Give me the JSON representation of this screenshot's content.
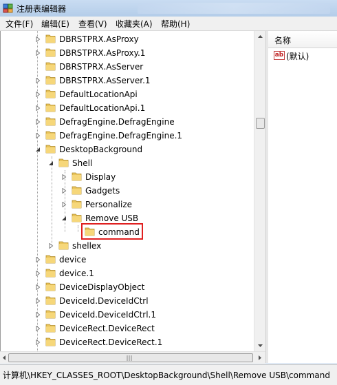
{
  "window": {
    "title": "注册表编辑器"
  },
  "menu": [
    "文件(F)",
    "编辑(E)",
    "查看(V)",
    "收藏夹(A)",
    "帮助(H)"
  ],
  "tree": [
    {
      "label": "DBRSTPRX.AsProxy",
      "level": 0,
      "expander": "collapsed"
    },
    {
      "label": "DBRSTPRX.AsProxy.1",
      "level": 0,
      "expander": "collapsed"
    },
    {
      "label": "DBRSTPRX.AsServer",
      "level": 0,
      "expander": "none"
    },
    {
      "label": "DBRSTPRX.AsServer.1",
      "level": 0,
      "expander": "collapsed"
    },
    {
      "label": "DefaultLocationApi",
      "level": 0,
      "expander": "collapsed"
    },
    {
      "label": "DefaultLocationApi.1",
      "level": 0,
      "expander": "collapsed"
    },
    {
      "label": "DefragEngine.DefragEngine",
      "level": 0,
      "expander": "collapsed"
    },
    {
      "label": "DefragEngine.DefragEngine.1",
      "level": 0,
      "expander": "collapsed"
    },
    {
      "label": "DesktopBackground",
      "level": 0,
      "expander": "expanded"
    },
    {
      "label": "Shell",
      "level": 1,
      "expander": "expanded"
    },
    {
      "label": "Display",
      "level": 2,
      "expander": "collapsed"
    },
    {
      "label": "Gadgets",
      "level": 2,
      "expander": "collapsed"
    },
    {
      "label": "Personalize",
      "level": 2,
      "expander": "collapsed"
    },
    {
      "label": "Remove USB",
      "level": 2,
      "expander": "expanded"
    },
    {
      "label": "command",
      "level": 3,
      "expander": "none",
      "selected": true
    },
    {
      "label": "shellex",
      "level": 1,
      "expander": "collapsed"
    },
    {
      "label": "device",
      "level": 0,
      "expander": "collapsed"
    },
    {
      "label": "device.1",
      "level": 0,
      "expander": "collapsed"
    },
    {
      "label": "DeviceDisplayObject",
      "level": 0,
      "expander": "collapsed"
    },
    {
      "label": "DeviceId.DeviceIdCtrl",
      "level": 0,
      "expander": "collapsed"
    },
    {
      "label": "DeviceId.DeviceIdCtrl.1",
      "level": 0,
      "expander": "collapsed"
    },
    {
      "label": "DeviceRect.DeviceRect",
      "level": 0,
      "expander": "collapsed"
    },
    {
      "label": "DeviceRect.DeviceRect.1",
      "level": 0,
      "expander": "collapsed"
    }
  ],
  "values_panel": {
    "column_name": "名称",
    "rows": [
      {
        "name": "(默认)",
        "icon": "string-value-icon"
      }
    ]
  },
  "status": {
    "path": "计算机\\HKEY_CLASSES_ROOT\\DesktopBackground\\Shell\\Remove USB\\command"
  },
  "colors": {
    "selection_outline": "#e02020",
    "folder": "#e8c35a"
  }
}
